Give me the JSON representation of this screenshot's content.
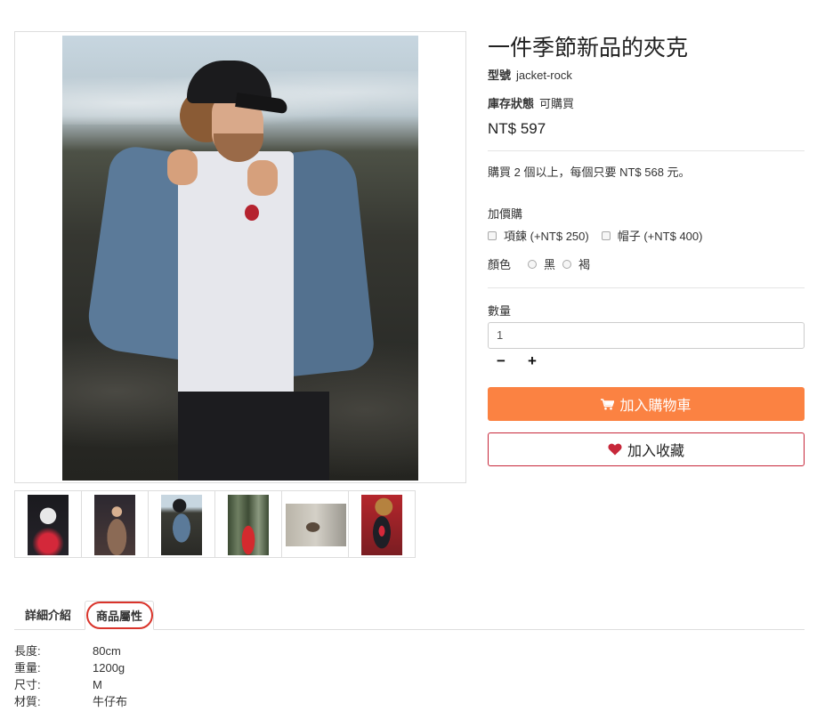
{
  "product": {
    "title": "一件季節新品的夾克",
    "model_label": "型號",
    "model_value": "jacket-rock",
    "stock_label": "庫存狀態",
    "stock_value": "可購買",
    "price": "NT$ 597",
    "bulk_offer": "購買 2 個以上，每個只要 NT$ 568 元。"
  },
  "addons": {
    "label": "加價購",
    "items": [
      {
        "label": "項鍊 (+NT$ 250)",
        "checked": false
      },
      {
        "label": "帽子 (+NT$ 400)",
        "checked": false
      }
    ]
  },
  "color": {
    "label": "顏色",
    "options": [
      {
        "label": "黑",
        "selected": false
      },
      {
        "label": "褐",
        "selected": false
      }
    ]
  },
  "quantity": {
    "label": "數量",
    "value": "1",
    "decrease_symbol": "−",
    "increase_symbol": "+"
  },
  "actions": {
    "add_to_cart": "加入購物車",
    "add_to_wishlist": "加入收藏"
  },
  "tabs": [
    {
      "label": "詳細介紹",
      "active": false
    },
    {
      "label": "商品屬性",
      "active": true
    }
  ],
  "specs": [
    {
      "key": "長度:",
      "value": "80cm"
    },
    {
      "key": "重量:",
      "value": "1200g"
    },
    {
      "key": "尺寸:",
      "value": "M"
    },
    {
      "key": "材質:",
      "value": "牛仔布"
    }
  ],
  "thumbnails": [
    {
      "subject": "masked person with red light"
    },
    {
      "subject": "woman in coat with lights"
    },
    {
      "subject": "man in denim jacket"
    },
    {
      "subject": "person in red jacket in forest"
    },
    {
      "subject": "man leaning by wall"
    },
    {
      "subject": "woman in track jacket"
    }
  ],
  "colors": {
    "cart_button": "#fb8242",
    "wishlist_border": "#c7273a",
    "heart_icon": "#c7273a",
    "tab_highlight_circle": "#d9342b"
  },
  "icons": {
    "cart": "shopping-cart-icon",
    "wishlist": "heart-icon"
  }
}
